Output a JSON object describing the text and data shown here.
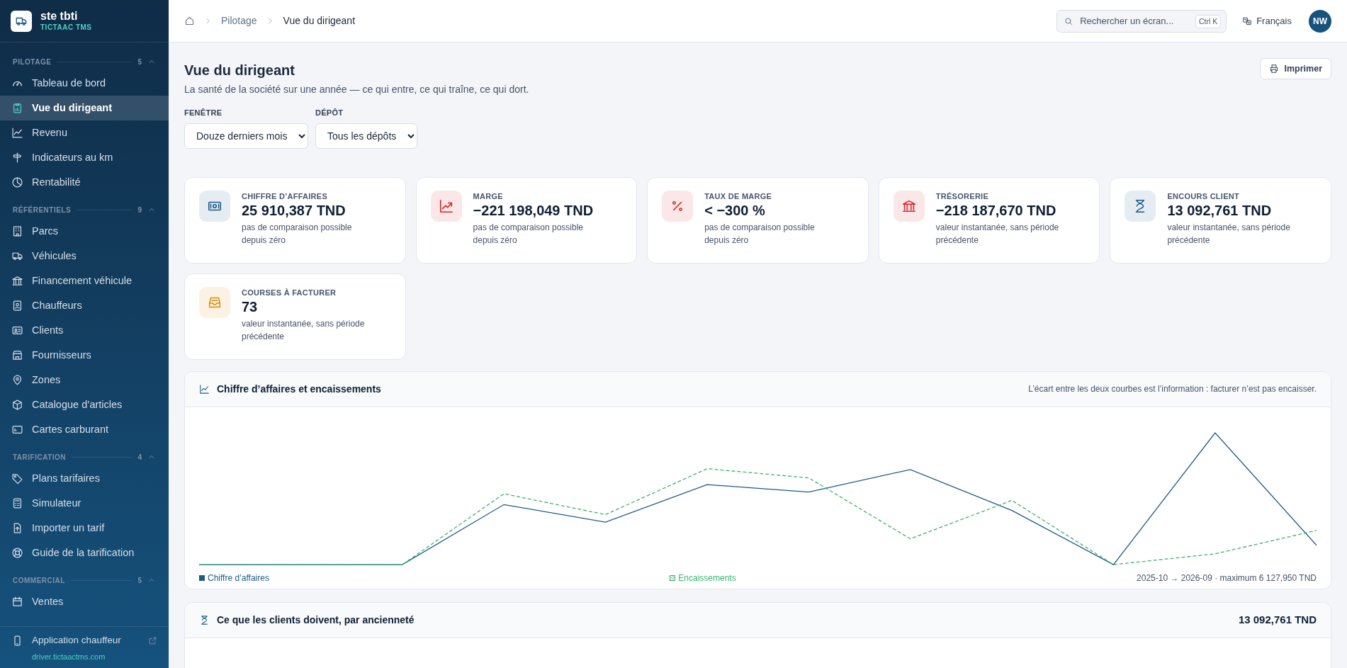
{
  "brand": {
    "name": "ste tbti",
    "subtitle": "TICTAAC TMS"
  },
  "sidebar": {
    "groups": [
      {
        "title": "PILOTAGE",
        "count": "5",
        "expanded": true,
        "items": [
          {
            "label": "Tableau de bord",
            "selected": false
          },
          {
            "label": "Vue du dirigeant",
            "selected": true
          },
          {
            "label": "Revenu",
            "selected": false
          },
          {
            "label": "Indicateurs au km",
            "selected": false
          },
          {
            "label": "Rentabilité",
            "selected": false
          }
        ]
      },
      {
        "title": "RÉFÉRENTIELS",
        "count": "9",
        "expanded": true,
        "items": [
          {
            "label": "Parcs",
            "selected": false
          },
          {
            "label": "Véhicules",
            "selected": false
          },
          {
            "label": "Financement véhicule",
            "selected": false
          },
          {
            "label": "Chauffeurs",
            "selected": false
          },
          {
            "label": "Clients",
            "selected": false
          },
          {
            "label": "Fournisseurs",
            "selected": false
          },
          {
            "label": "Zones",
            "selected": false
          },
          {
            "label": "Catalogue d’articles",
            "selected": false
          },
          {
            "label": "Cartes carburant",
            "selected": false
          }
        ]
      },
      {
        "title": "TARIFICATION",
        "count": "4",
        "expanded": true,
        "items": [
          {
            "label": "Plans tarifaires",
            "selected": false
          },
          {
            "label": "Simulateur",
            "selected": false
          },
          {
            "label": "Importer un tarif",
            "selected": false
          },
          {
            "label": "Guide de la tarification",
            "selected": false
          }
        ]
      },
      {
        "title": "COMMERCIAL",
        "count": "5",
        "expanded": true,
        "items": [
          {
            "label": "Ventes",
            "selected": false
          }
        ]
      }
    ],
    "footer": {
      "label": "Application chauffeur",
      "link": "driver.tictaactms.com"
    }
  },
  "breadcrumb": [
    "Pilotage",
    "Vue du dirigeant"
  ],
  "search": {
    "placeholder": "Rechercher un écran...",
    "shortcut": "Ctrl K"
  },
  "language": "Français",
  "avatar": "NW",
  "page": {
    "title": "Vue du dirigeant",
    "subtitle": "La santé de la société sur une année — ce qui entre, ce qui traîne, ce qui dort.",
    "print_button": "Imprimer"
  },
  "filters": [
    {
      "label": "FENÊTRE",
      "value": "Douze derniers mois"
    },
    {
      "label": "DÉPÔT",
      "value": "Tous les dépôts"
    }
  ],
  "kpis": [
    {
      "title": "CHIFFRE D’AFFAIRES",
      "value": "25 910,387 TND",
      "note": "pas de comparaison possible depuis zéro",
      "color": "#1d5a85"
    },
    {
      "title": "MARGE",
      "value": "−221 198,049 TND",
      "note": "pas de comparaison possible depuis zéro",
      "color": "#dc2626"
    },
    {
      "title": "TAUX DE MARGE",
      "value": "< −300 %",
      "note": "pas de comparaison possible depuis zéro",
      "color": "#dc2626"
    },
    {
      "title": "TRÉSORERIE",
      "value": "−218 187,670 TND",
      "note": "valeur instantanée, sans période précédente",
      "color": "#dc2626"
    },
    {
      "title": "ENCOURS CLIENT",
      "value": "13 092,761 TND",
      "note": "valeur instantanée, sans période précédente",
      "color": "#1d5a85"
    },
    {
      "title": "COURSES À FACTURER",
      "value": "73",
      "note": "valeur instantanée, sans période précédente",
      "color": "#e08a00"
    }
  ],
  "revenue_card": {
    "title": "Chiffre d’affaires et encaissements",
    "hint": "L’écart entre les deux courbes est l’information : facturer n’est pas encaisser.",
    "legend": [
      {
        "label": "Chiffre d’affaires",
        "color": "#1d5a85"
      },
      {
        "label": "Encaissements",
        "color": "#3cb371"
      }
    ],
    "range": "2025-10 → 2026-09 · maximum 6 127,950 TND"
  },
  "aging_card": {
    "title": "Ce que les clients doivent, par ancienneté",
    "total": "13 092,761 TND"
  }
}
